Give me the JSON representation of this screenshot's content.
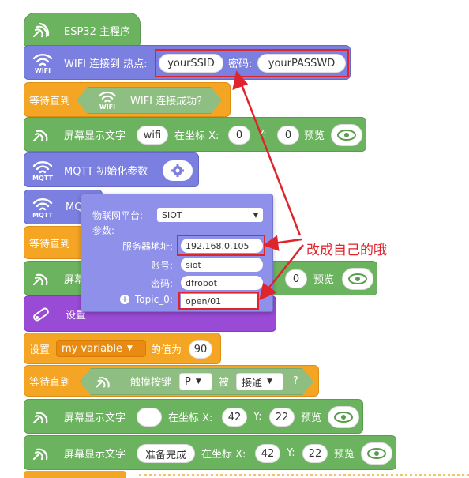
{
  "blocks": {
    "main": {
      "label": "ESP32 主程序"
    },
    "wifi_connect": {
      "icon_text": "WIFI",
      "label": "WIFI 连接到 热点:",
      "ssid": "yourSSID",
      "pwd_label": "密码:",
      "password": "yourPASSWD"
    },
    "wait_wifi": {
      "label": "等待直到",
      "cond_icon_text": "WIFI",
      "cond_label": "WIFI 连接成功？"
    },
    "show_text_1": {
      "label": "屏幕显示文字",
      "text": "wifi",
      "at_label": "在坐标 X:",
      "x": "0",
      "y_label": "Y:",
      "y": "0",
      "preview_label": "预览"
    },
    "mqtt_init": {
      "icon_text": "MQTT",
      "label": "MQTT 初始化参数"
    },
    "mqtt_connect": {
      "icon_text": "MQTT",
      "label_partial": "MQ"
    },
    "wait_2": {
      "label": "等待直到"
    },
    "show_text_2": {
      "label_partial": "屏幕",
      "y_value": "0",
      "preview_label": "预览"
    },
    "servo_set": {
      "label_partial": "设置"
    },
    "set_var": {
      "label": "设置",
      "var_name": "my variable",
      "value_label": "的值为",
      "value": "90"
    },
    "wait_touch": {
      "label": "等待直到",
      "touch_label": "触摸按键",
      "pin": "P",
      "by_label": "被",
      "state": "接通",
      "q": "?"
    },
    "show_text_3": {
      "label": "屏幕显示文字",
      "text": "",
      "at_label": "在坐标 X:",
      "x": "42",
      "y_label": "Y:",
      "y": "22",
      "preview_label": "预览"
    },
    "show_text_4": {
      "label": "屏幕显示文字",
      "text": "准备完成",
      "at_label": "在坐标 X:",
      "x": "42",
      "y_label": "Y:",
      "y": "22",
      "preview_label": "预览"
    }
  },
  "popup": {
    "platform_label": "物联网平台:",
    "platform_value": "SIOT",
    "params_label": "参数:",
    "server_label": "服务器地址:",
    "server_value": "192.168.0.105",
    "account_label": "账号:",
    "account_value": "siot",
    "password_label": "密码:",
    "password_value": "dfrobot",
    "topic_label": "Topic_0:",
    "topic_value": "open/01"
  },
  "annotation": {
    "text": "改成自己的哦",
    "color": "#e0242b"
  },
  "colors": {
    "green": "#6cb35f",
    "purple": "#7b7fe0",
    "orange": "#f5a524",
    "violet": "#9a4bd6",
    "red": "#e0242b"
  }
}
